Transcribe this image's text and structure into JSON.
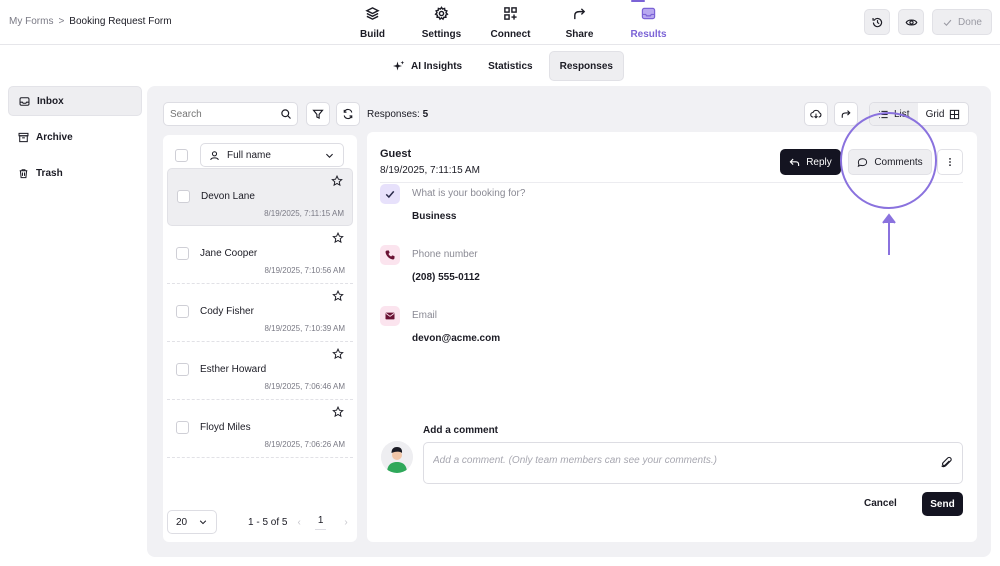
{
  "breadcrumb": {
    "root": "My Forms",
    "separator": ">",
    "current": "Booking Request Form"
  },
  "nav": {
    "items": [
      {
        "label": "Build",
        "icon": "layers-icon"
      },
      {
        "label": "Settings",
        "icon": "gear-icon"
      },
      {
        "label": "Connect",
        "icon": "connect-icon"
      },
      {
        "label": "Share",
        "icon": "share-arrow-icon"
      },
      {
        "label": "Results",
        "icon": "inbox-icon"
      }
    ],
    "active": "Results"
  },
  "top_actions": {
    "history_icon": "history-icon",
    "preview_icon": "eye-icon",
    "done_label": "Done"
  },
  "subtabs": [
    {
      "label": "AI Insights",
      "icon": "sparkle-icon"
    },
    {
      "label": "Statistics"
    },
    {
      "label": "Responses"
    }
  ],
  "sidebar": {
    "items": [
      {
        "label": "Inbox",
        "icon": "inbox-icon"
      },
      {
        "label": "Archive",
        "icon": "archive-icon"
      },
      {
        "label": "Trash",
        "icon": "trash-icon"
      }
    ]
  },
  "toolbar": {
    "search_placeholder": "Search",
    "responses_label": "Responses:",
    "responses_count": "5",
    "list_label": "List",
    "grid_label": "Grid"
  },
  "list": {
    "column_select": "Full name",
    "rows": [
      {
        "name": "Devon Lane",
        "date": "8/19/2025, 7:11:15 AM"
      },
      {
        "name": "Jane Cooper",
        "date": "8/19/2025, 7:10:56 AM"
      },
      {
        "name": "Cody Fisher",
        "date": "8/19/2025, 7:10:39 AM"
      },
      {
        "name": "Esther Howard",
        "date": "8/19/2025, 7:06:46 AM"
      },
      {
        "name": "Floyd Miles",
        "date": "8/19/2025, 7:06:26 AM"
      }
    ],
    "page_size": "20",
    "page_info": "1 - 5 of 5",
    "page_number": "1",
    "prev": "‹",
    "next": "›"
  },
  "detail": {
    "name": "Guest",
    "date": "8/19/2025, 7:11:15 AM",
    "reply_label": "Reply",
    "comments_label": "Comments",
    "fields": [
      {
        "label": "What is your booking for?",
        "value": "Business",
        "icon": "check-icon"
      },
      {
        "label": "Phone number",
        "value": "(208) 555-0112",
        "icon": "phone-icon"
      },
      {
        "label": "Email",
        "value": "devon@acme.com",
        "icon": "mail-icon"
      }
    ],
    "add_comment_label": "Add a comment",
    "comment_placeholder": "Add a comment. (Only team members can see your comments.)",
    "cancel_label": "Cancel",
    "send_label": "Send"
  },
  "colors": {
    "accent": "#7b63d6",
    "dark": "#141421",
    "panel": "#f1f1f4"
  }
}
